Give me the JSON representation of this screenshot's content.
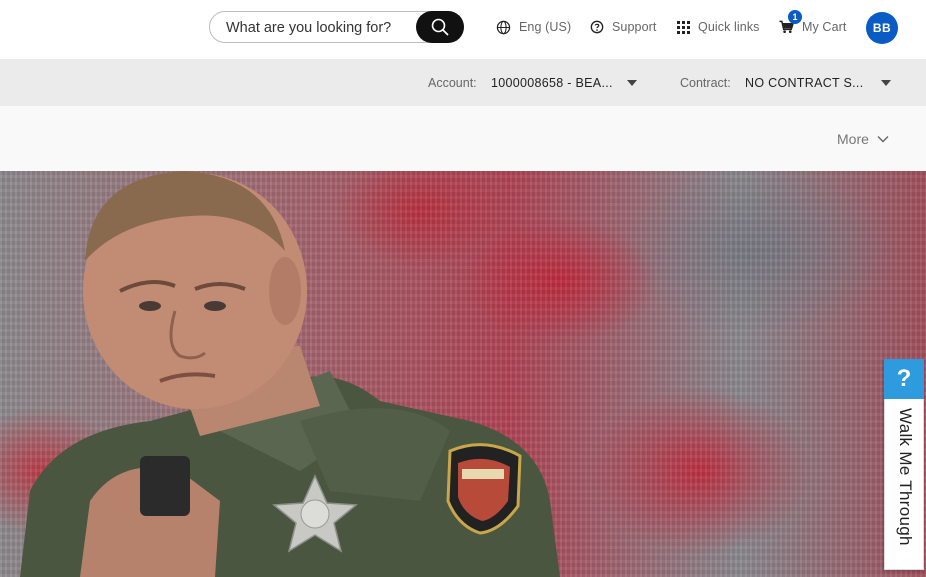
{
  "header": {
    "search": {
      "placeholder": "What are you looking for?"
    },
    "language": "Eng (US)",
    "support": "Support",
    "quick_links": "Quick links",
    "cart": {
      "label": "My Cart",
      "count": "1"
    },
    "avatar_initials": "BB"
  },
  "account_bar": {
    "account_label": "Account:",
    "account_value": "1000008658 - BEA...",
    "contract_label": "Contract:",
    "contract_value": "NO CONTRACT S..."
  },
  "nav": {
    "more_label": "More"
  },
  "help_widget": {
    "icon": "?",
    "label": "Walk Me Through"
  },
  "colors": {
    "brand_blue": "#0a5bc4",
    "help_blue": "#2d9bdd",
    "account_bar_bg": "#ebebeb"
  }
}
